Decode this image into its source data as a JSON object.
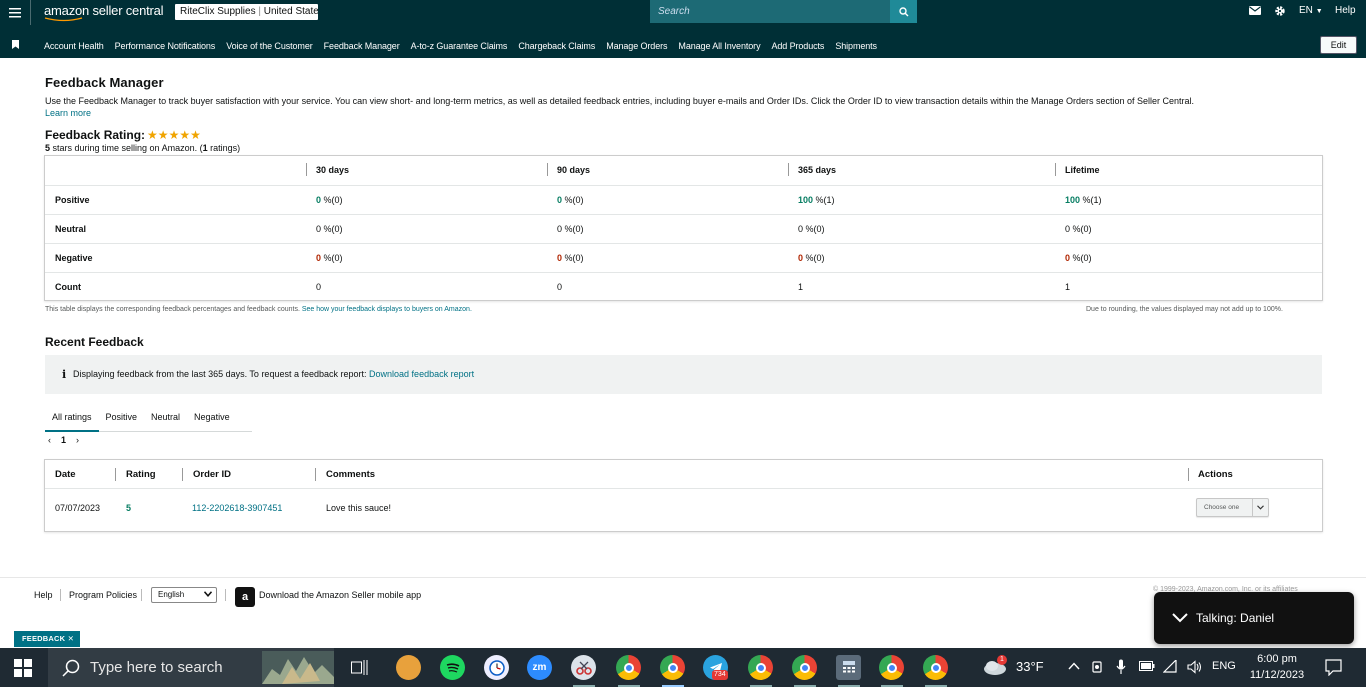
{
  "header": {
    "brand": "amazon seller central",
    "store": "RiteClix Supplies",
    "marketplace": "United States",
    "search_placeholder": "Search",
    "lang": "EN",
    "help": "Help"
  },
  "nav": {
    "items": [
      "Account Health",
      "Performance Notifications",
      "Voice of the Customer",
      "Feedback Manager",
      "A-to-z Guarantee Claims",
      "Chargeback Claims",
      "Manage Orders",
      "Manage All Inventory",
      "Add Products",
      "Shipments"
    ],
    "edit": "Edit"
  },
  "page": {
    "title": "Feedback Manager",
    "description": "Use the Feedback Manager to track buyer satisfaction with your service. You can view short- and long-term metrics, as well as detailed feedback entries, including buyer e-mails and Order IDs. Click the Order ID to view transaction details within the Manage Orders section of Seller Central.",
    "learn_more": "Learn more",
    "rating_title": "Feedback Rating:",
    "rating_stars": 5,
    "rating_sub_stars": "5",
    "rating_sub_text1": " stars during time selling on Amazon. (",
    "rating_sub_count": "1",
    "rating_sub_text2": " ratings)"
  },
  "feedback_table": {
    "columns": [
      "30 days",
      "90 days",
      "365 days",
      "Lifetime"
    ],
    "rows": [
      {
        "label": "Positive",
        "cells": [
          {
            "v": "0",
            "p": " %(0)"
          },
          {
            "v": "0",
            "p": " %(0)"
          },
          {
            "v": "100",
            "p": " %(1)"
          },
          {
            "v": "100",
            "p": " %(1)"
          }
        ]
      },
      {
        "label": "Neutral",
        "cells": [
          {
            "v": "0",
            "p": " %(0)"
          },
          {
            "v": "0",
            "p": " %(0)"
          },
          {
            "v": "0",
            "p": " %(0)"
          },
          {
            "v": "0",
            "p": " %(0)"
          }
        ]
      },
      {
        "label": "Negative",
        "cells": [
          {
            "v": "0",
            "p": " %(0)"
          },
          {
            "v": "0",
            "p": " %(0)"
          },
          {
            "v": "0",
            "p": " %(0)"
          },
          {
            "v": "0",
            "p": " %(0)"
          }
        ]
      },
      {
        "label": "Count",
        "cells": [
          {
            "v": "0",
            "p": ""
          },
          {
            "v": "0",
            "p": ""
          },
          {
            "v": "1",
            "p": ""
          },
          {
            "v": "1",
            "p": ""
          }
        ]
      }
    ],
    "note_left": "This table displays the corresponding feedback percentages and feedback counts.",
    "note_left_link": "See how your feedback displays to buyers on Amazon.",
    "note_right": "Due to rounding, the values displayed may not add up to 100%."
  },
  "recent": {
    "title": "Recent Feedback",
    "info_text": "Displaying feedback from the last 365 days. To request a feedback report:",
    "info_link": "Download feedback report",
    "tabs": [
      "All ratings",
      "Positive",
      "Neutral",
      "Negative"
    ],
    "page": "1",
    "columns": [
      "Date",
      "Rating",
      "Order ID",
      "Comments",
      "Actions"
    ],
    "rows": [
      {
        "date": "07/07/2023",
        "rating": "5",
        "order_id": "112-2202618-3907451",
        "comment": "Love this sauce!",
        "action": "Choose one"
      }
    ]
  },
  "footer": {
    "help": "Help",
    "policies": "Program Policies",
    "language": "English",
    "app": "Download the Amazon Seller mobile app",
    "copyright": "© 1999-2023, Amazon.com, Inc. or its affiliates"
  },
  "toast": {
    "text": "Talking: Daniel"
  },
  "feedback_tab": "FEEDBACK",
  "taskbar": {
    "search": "Type here to search",
    "temp": "33°F",
    "lang": "ENG",
    "time": "6:00 pm",
    "date": "11/12/2023",
    "telegram_badge": "734",
    "weather_badge": "1"
  },
  "colors": {
    "header_bg": "#002f36",
    "link": "#007185",
    "positive": "#067d62",
    "negative": "#b12704",
    "star": "#f0a400"
  }
}
